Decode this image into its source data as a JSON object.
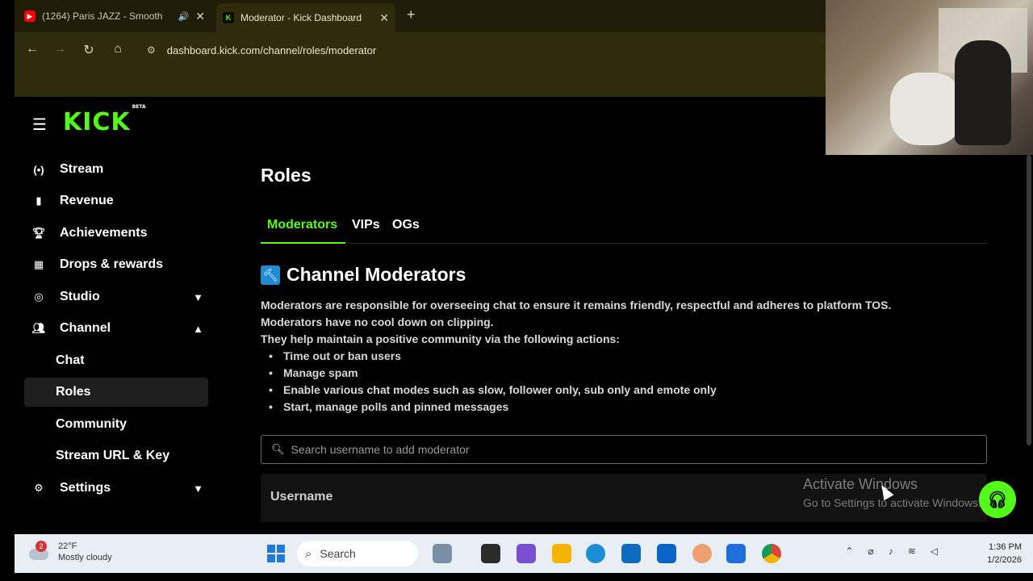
{
  "browser": {
    "tabs": [
      {
        "title": "(1264) Paris JAZZ - Smooth",
        "favicon": "youtube-icon"
      },
      {
        "title": "Moderator - Kick Dashboard",
        "favicon": "kick-icon",
        "active": true
      }
    ],
    "url": "dashboard.kick.com/channel/roles/moderator"
  },
  "sidebar": {
    "logo": "KICK",
    "logo_sup": "BETA",
    "items": [
      {
        "label": "Stream",
        "icon": "broadcast-icon"
      },
      {
        "label": "Revenue",
        "icon": "chart-icon"
      },
      {
        "label": "Achievements",
        "icon": "trophy-icon"
      },
      {
        "label": "Drops & rewards",
        "icon": "gift-icon"
      },
      {
        "label": "Studio",
        "icon": "studio-icon",
        "chevron": "down"
      },
      {
        "label": "Channel",
        "icon": "users-icon",
        "chevron": "up"
      },
      {
        "label": "Chat",
        "sub": true
      },
      {
        "label": "Roles",
        "sub": true,
        "active": true
      },
      {
        "label": "Community",
        "sub": true
      },
      {
        "label": "Stream URL & Key",
        "sub": true
      },
      {
        "label": "Settings",
        "icon": "gear-icon",
        "chevron": "down"
      }
    ]
  },
  "main": {
    "title": "Roles",
    "tabs": [
      "Moderators",
      "VIPs",
      "OGs"
    ],
    "section_title": "Channel Moderators",
    "desc": [
      "Moderators are responsible for overseeing chat to ensure it remains friendly, respectful and adheres to platform TOS.",
      "Moderators have no cool down on clipping.",
      "They help maintain a positive community via the following actions:"
    ],
    "bullets": [
      "Time out or ban users",
      "Manage spam",
      "Enable various chat modes such as slow, follower only, sub only and emote only",
      "Start, manage polls and pinned messages"
    ],
    "search_placeholder": "Search username to add moderator",
    "table_header": "Username"
  },
  "watermark": {
    "line1": "Activate Windows",
    "line2": "Go to Settings to activate Windows."
  },
  "taskbar": {
    "weather_temp": "22°F",
    "weather_desc": "Mostly cloudy",
    "weather_badge": "2",
    "search_label": "Search",
    "time": "1:36 PM",
    "date": "1/2/2026"
  },
  "colors": {
    "accent": "#53fc18",
    "chrome_bg": "#2f2c0e",
    "page_bg": "#000000"
  }
}
